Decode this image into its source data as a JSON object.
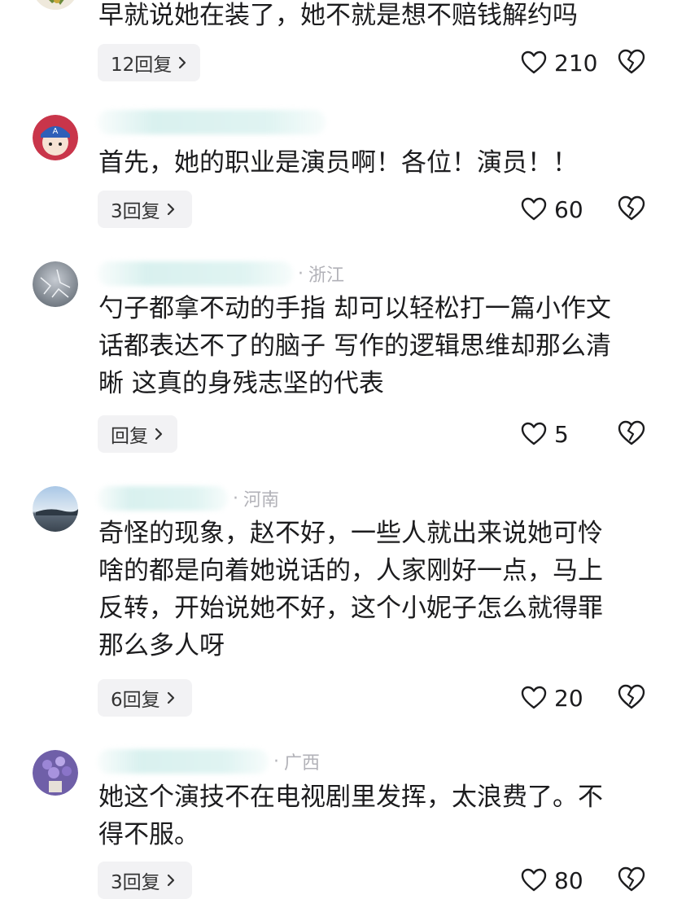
{
  "comments": [
    {
      "author": "",
      "region": "",
      "text": "早就说她在装了，她不就是想不赔钱解约吗",
      "reply_label": "12回复",
      "likes": "210"
    },
    {
      "author": "",
      "region": "",
      "text": "首先，她的职业是演员啊！各位！演员！！",
      "reply_label": "3回复",
      "likes": "60"
    },
    {
      "author": "",
      "region": "浙江",
      "text": "勺子都拿不动的手指 却可以轻松打一篇小作文\n话都表达不了的脑子 写作的逻辑思维却那么清\n晰 这真的身残志坚的代表",
      "reply_label": "回复",
      "likes": "5"
    },
    {
      "author": "",
      "region": "河南",
      "text": "奇怪的现象，赵不好，一些人就出来说她可怜\n啥的都是向着她说话的，人家刚好一点，马上\n反转，开始说她不好，这个小妮子怎么就得罪\n那么多人呀",
      "reply_label": "6回复",
      "likes": "20"
    },
    {
      "author": "",
      "region": "广西",
      "text": "她这个演技不在电视剧里发挥，太浪费了。不\n得不服。",
      "reply_label": "3回复",
      "likes": "80"
    }
  ],
  "colors": {
    "text": "#1c1c1e",
    "meta": "#b2b2b8",
    "reply_bg": "#f2f2f4",
    "blur": "#d7f0ee"
  },
  "icons": {
    "like": "heart-outline-icon",
    "dislike": "broken-heart-icon",
    "reply": "chevron-right-icon"
  }
}
